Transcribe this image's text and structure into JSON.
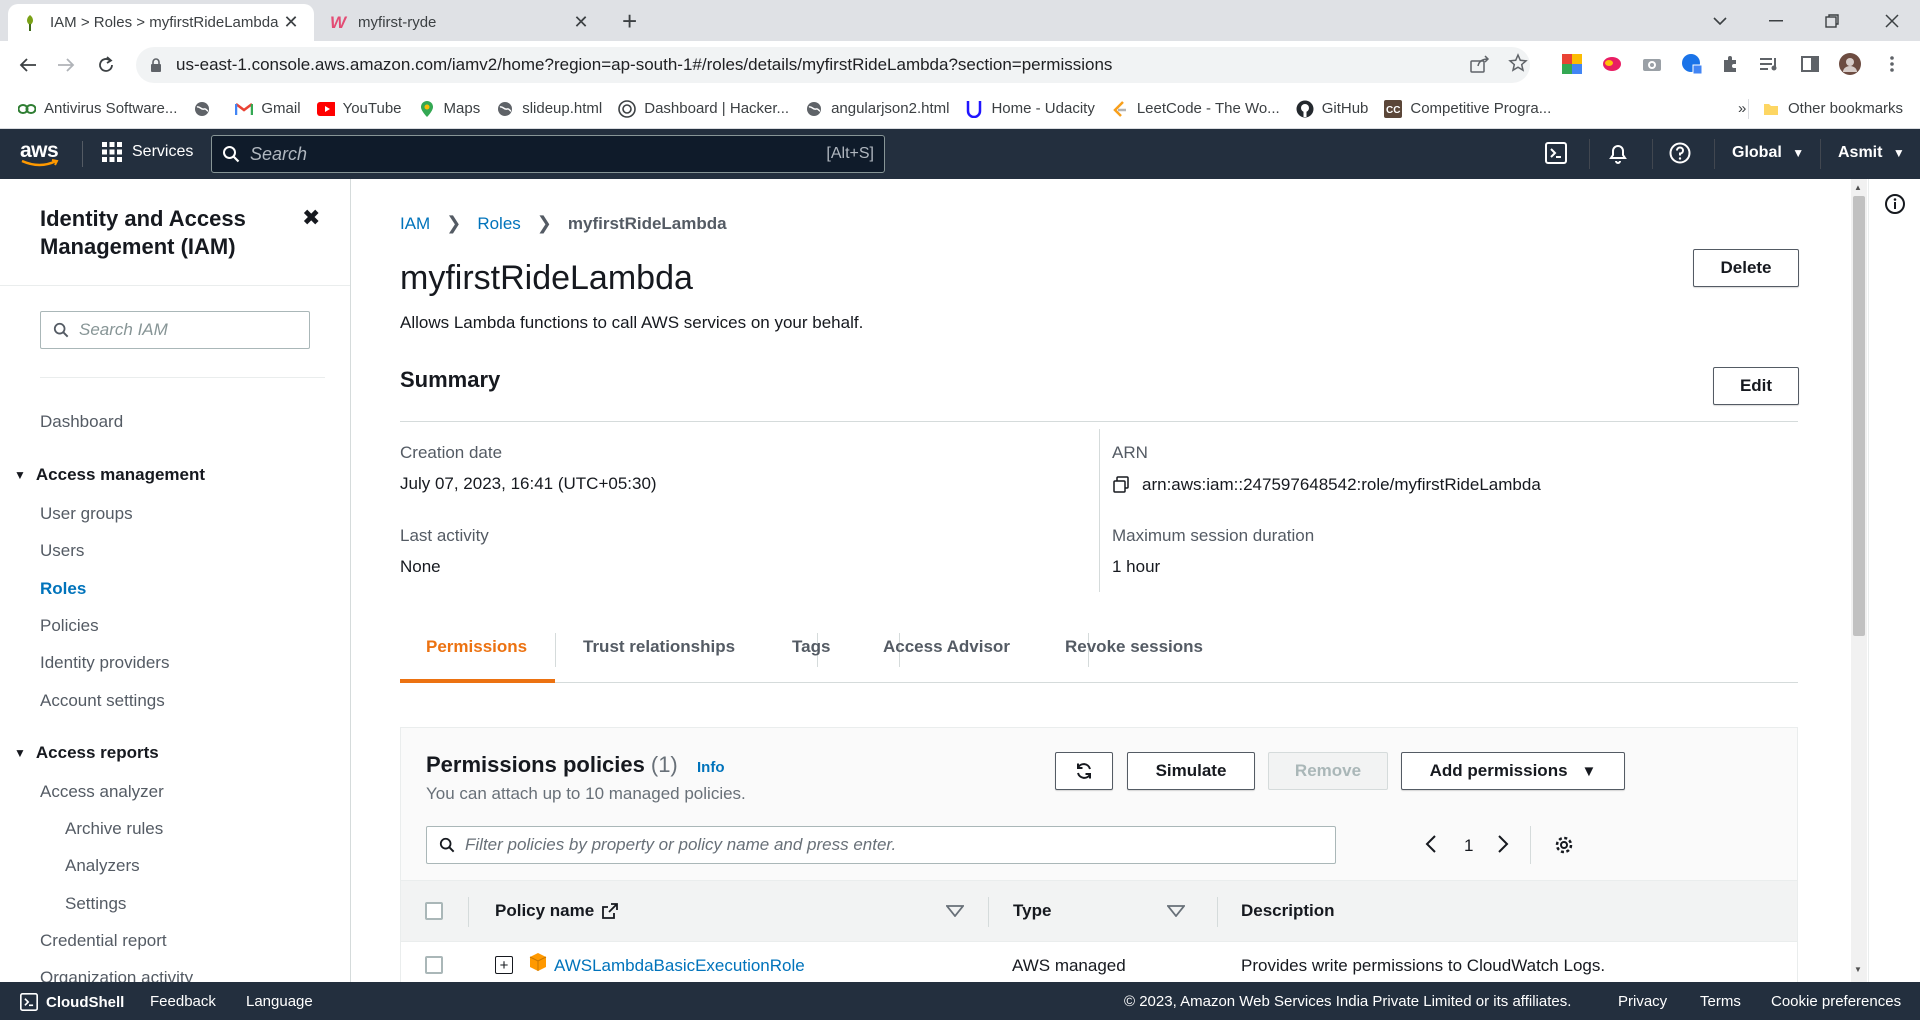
{
  "browser": {
    "tabs": [
      {
        "title": "IAM > Roles > myfirstRideLambda",
        "active": true
      },
      {
        "title": "myfirst-ryde",
        "active": false
      }
    ],
    "url": "us-east-1.console.aws.amazon.com/iamv2/home?region=ap-south-1#/roles/details/myfirstRideLambda?section=permissions",
    "bookmarks": [
      {
        "label": "Antivirus Software...",
        "icon": "antivirus-icon"
      },
      {
        "label": "",
        "icon": "globe-icon"
      },
      {
        "label": "Gmail",
        "icon": "gmail-icon"
      },
      {
        "label": "YouTube",
        "icon": "youtube-icon"
      },
      {
        "label": "Maps",
        "icon": "maps-icon"
      },
      {
        "label": "slideup.html",
        "icon": "globe-icon"
      },
      {
        "label": "Dashboard | Hacker...",
        "icon": "hackerrank-icon"
      },
      {
        "label": "angularjson2.html",
        "icon": "globe-icon"
      },
      {
        "label": "Home - Udacity",
        "icon": "udacity-icon"
      },
      {
        "label": "LeetCode - The Wo...",
        "icon": "leetcode-icon"
      },
      {
        "label": "GitHub",
        "icon": "github-icon"
      },
      {
        "label": "Competitive Progra...",
        "icon": "cc-icon"
      }
    ],
    "bookmarks_more": "»",
    "other_bookmarks": "Other bookmarks"
  },
  "aws_header": {
    "logo": "aws",
    "services": "Services",
    "search_placeholder": "Search",
    "search_shortcut": "[Alt+S]",
    "region": "Global",
    "user": "Asmit"
  },
  "sidebar": {
    "title": "Identity and Access Management (IAM)",
    "search_placeholder": "Search IAM",
    "dashboard": "Dashboard",
    "access_management": "Access management",
    "am_items": [
      "User groups",
      "Users",
      "Roles",
      "Policies",
      "Identity providers",
      "Account settings"
    ],
    "access_reports": "Access reports",
    "access_analyzer": "Access analyzer",
    "analyzer_items": [
      "Archive rules",
      "Analyzers",
      "Settings"
    ],
    "credential_report": "Credential report",
    "organization_activity": "Organization activity"
  },
  "main": {
    "breadcrumb": [
      "IAM",
      "Roles",
      "myfirstRideLambda"
    ],
    "title": "myfirstRideLambda",
    "description": "Allows Lambda functions to call AWS services on your behalf.",
    "delete": "Delete",
    "summary": "Summary",
    "edit": "Edit",
    "creation_date_label": "Creation date",
    "creation_date": "July 07, 2023, 16:41 (UTC+05:30)",
    "last_activity_label": "Last activity",
    "last_activity": "None",
    "arn_label": "ARN",
    "arn": "arn:aws:iam::247597648542:role/myfirstRideLambda",
    "max_session_label": "Maximum session duration",
    "max_session": "1 hour",
    "tabs": [
      "Permissions",
      "Trust relationships",
      "Tags",
      "Access Advisor",
      "Revoke sessions"
    ],
    "permissions": {
      "title": "Permissions policies",
      "count": "(1)",
      "info": "Info",
      "subtitle": "You can attach up to 10 managed policies.",
      "simulate": "Simulate",
      "remove": "Remove",
      "add_permissions": "Add permissions",
      "filter_placeholder": "Filter policies by property or policy name and press enter.",
      "page": "1",
      "columns": [
        "Policy name",
        "Type",
        "Description"
      ],
      "rows": [
        {
          "name": "AWSLambdaBasicExecutionRole",
          "type": "AWS managed",
          "description": "Provides write permissions to CloudWatch Logs."
        }
      ]
    }
  },
  "footer": {
    "cloudshell": "CloudShell",
    "feedback": "Feedback",
    "language": "Language",
    "copyright": "© 2023, Amazon Web Services India Private Limited or its affiliates.",
    "privacy": "Privacy",
    "terms": "Terms",
    "cookies": "Cookie preferences"
  },
  "colors": {
    "aws_header": "#232f3e",
    "link": "#0073bb",
    "tab_active": "#ec7211"
  }
}
